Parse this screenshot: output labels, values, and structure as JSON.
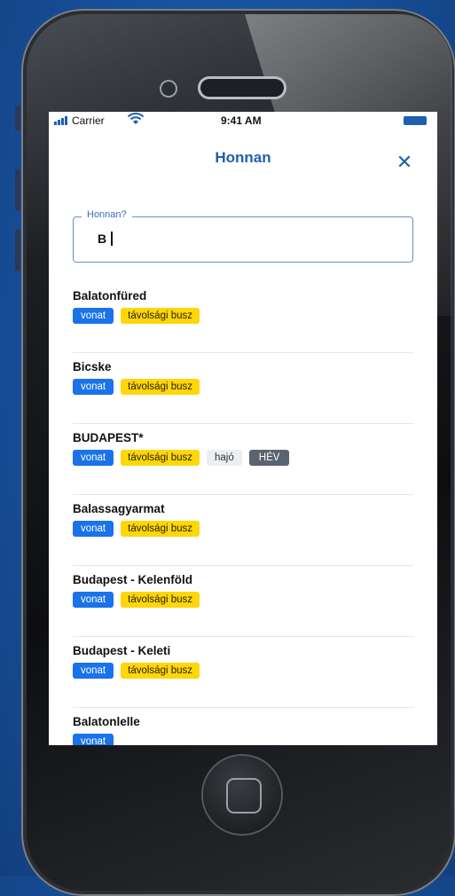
{
  "status": {
    "carrier": "Carrier",
    "time": "9:41 AM"
  },
  "header": {
    "title": "Honnan",
    "close": "✕"
  },
  "search": {
    "label": "Honnan?",
    "value": "B"
  },
  "results": [
    {
      "name": "Balatonfüred",
      "tags": [
        {
          "label": "vonat",
          "type": "vonat"
        },
        {
          "label": "távolsági busz",
          "type": "busz"
        }
      ]
    },
    {
      "name": "Bicske",
      "tags": [
        {
          "label": "vonat",
          "type": "vonat"
        },
        {
          "label": "távolsági busz",
          "type": "busz"
        }
      ]
    },
    {
      "name": "BUDAPEST*",
      "tags": [
        {
          "label": "vonat",
          "type": "vonat"
        },
        {
          "label": "távolsági busz",
          "type": "busz"
        },
        {
          "label": "hajó",
          "type": "hajo"
        },
        {
          "label": "HÉV",
          "type": "hev"
        }
      ]
    },
    {
      "name": "Balassagyarmat",
      "tags": [
        {
          "label": "vonat",
          "type": "vonat"
        },
        {
          "label": "távolsági busz",
          "type": "busz"
        }
      ]
    },
    {
      "name": "Budapest - Kelenföld",
      "tags": [
        {
          "label": "vonat",
          "type": "vonat"
        },
        {
          "label": "távolsági busz",
          "type": "busz"
        }
      ]
    },
    {
      "name": "Budapest - Keleti",
      "tags": [
        {
          "label": "vonat",
          "type": "vonat"
        },
        {
          "label": "távolsági busz",
          "type": "busz"
        }
      ]
    },
    {
      "name": "Balatonlelle",
      "tags": [
        {
          "label": "vonat",
          "type": "vonat"
        }
      ]
    }
  ]
}
